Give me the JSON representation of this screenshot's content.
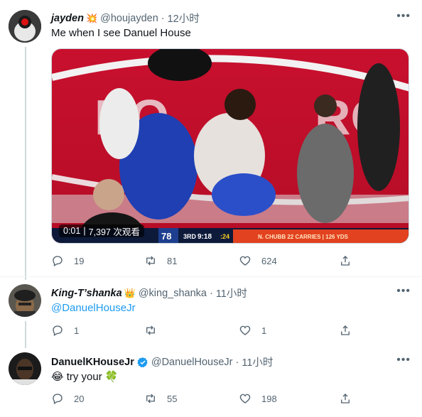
{
  "tweets": [
    {
      "display_name": "jayden",
      "name_emoji": "💥",
      "handle": "@houjayden",
      "time": "12小时",
      "text": "Me when I see Danuel House",
      "video": {
        "elapsed": "0:01",
        "views": "7,397 次观看"
      },
      "actions": {
        "replies": "19",
        "retweets": "81",
        "likes": "624"
      }
    },
    {
      "display_name": "King-T’shanka",
      "name_emoji": "👑",
      "handle": "@king_shanka",
      "time": "11小时",
      "mention": "@DanuelHouseJr",
      "actions": {
        "replies": "1",
        "retweets": "",
        "likes": "1"
      }
    },
    {
      "display_name": "DanuelKHouseJr",
      "verified": true,
      "handle": "@DanuelHouseJr",
      "time": "11小时",
      "text_emoji": "😂",
      "text": "try your",
      "trailing_emoji": "🍀",
      "actions": {
        "replies": "20",
        "retweets": "55",
        "likes": "198"
      }
    }
  ],
  "scoreboard": {
    "score_home": "78",
    "quarter": "3RD",
    "clock": "9:18",
    "shot_clock": ":24",
    "ticker": "N. CHUBB 22 CARRIES | 126 YDS"
  },
  "icons": [
    "reply-icon",
    "retweet-icon",
    "like-icon",
    "share-icon",
    "more-icon",
    "verified-icon"
  ],
  "colors": {
    "accent": "#1d9bf0",
    "muted": "#536471",
    "court_red": "#c8102e"
  }
}
